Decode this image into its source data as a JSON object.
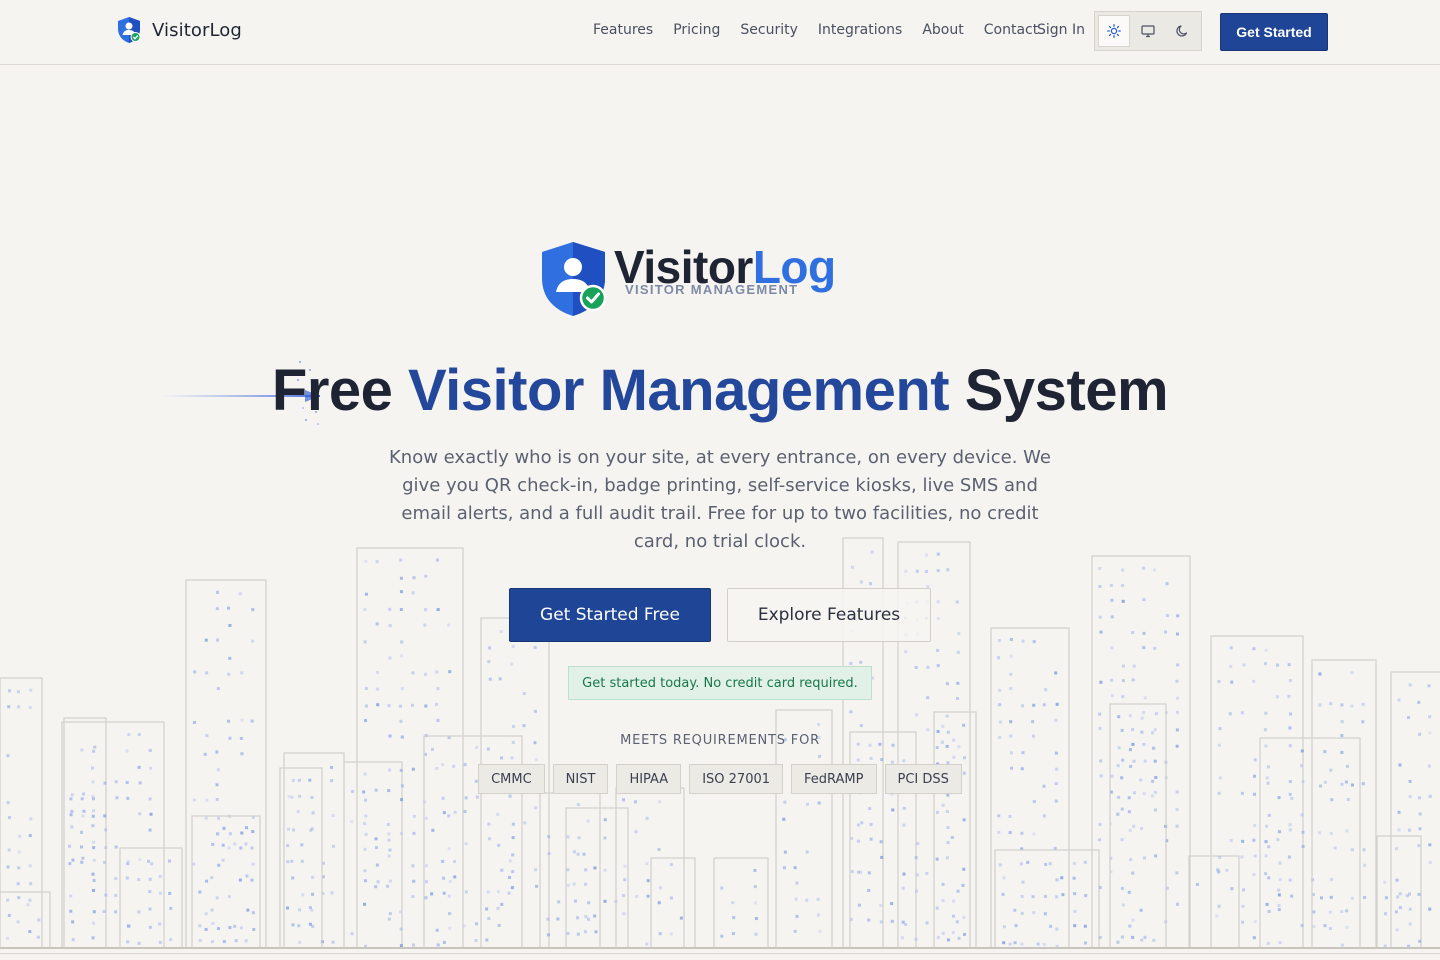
{
  "header": {
    "brand_name": "VisitorLog",
    "nav_items": [
      "Features",
      "Pricing",
      "Security",
      "Integrations",
      "About",
      "Contact"
    ],
    "sign_in_label": "Sign In",
    "theme_options": [
      {
        "name": "light",
        "icon": "sun-icon",
        "active": true
      },
      {
        "name": "system",
        "icon": "monitor-icon",
        "active": false
      },
      {
        "name": "dark",
        "icon": "moon-icon",
        "active": false
      }
    ],
    "cta_label": "Get Started"
  },
  "hero": {
    "logo": {
      "word_dark": "Visitor",
      "word_accent": "Log",
      "tagline": "VISITOR MANAGEMENT"
    },
    "headline_start": "Free ",
    "headline_highlight": "Visitor Management",
    "headline_end": " System",
    "subtitle": "Know exactly who is on your site, at every entrance, on every device. We give you QR check-in, badge printing, self-service kiosks, live SMS and email alerts, and a full audit trail. Free for up to two facilities, no credit card, no trial clock.",
    "primary_button": "Get Started Free",
    "secondary_button": "Explore Features",
    "note": "Get started today. No credit card required.",
    "requirements_label": "MEETS REQUIREMENTS FOR",
    "requirements": [
      "CMMC",
      "NIST",
      "HIPAA",
      "ISO 27001",
      "FedRAMP",
      "PCI DSS"
    ]
  },
  "colors": {
    "background": "#f5f4f1",
    "primary": "#1f4596",
    "accent_blue": "#2f6fe0",
    "success_green": "#17784a"
  }
}
